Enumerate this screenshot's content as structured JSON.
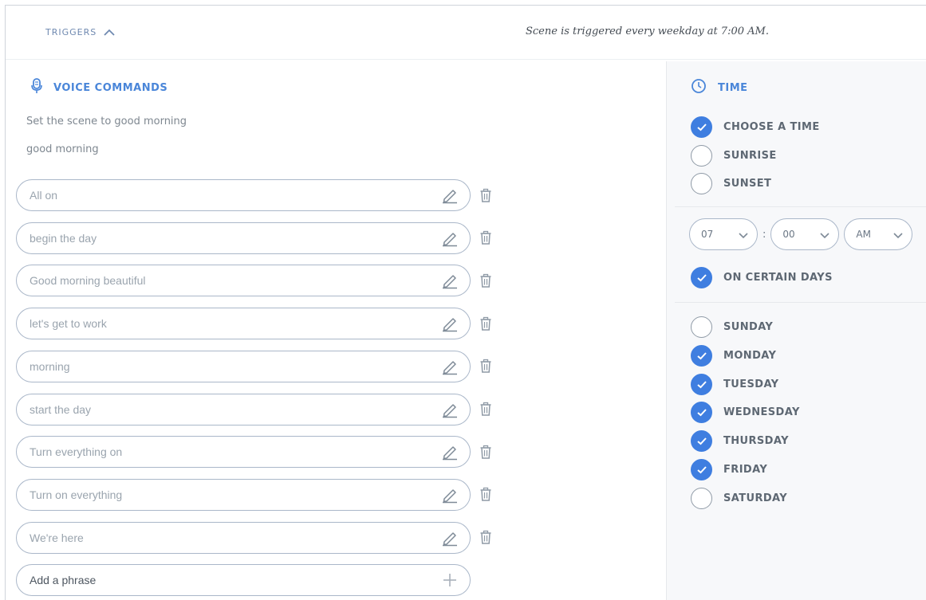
{
  "header": {
    "triggers_label": "TRIGGERS",
    "summary": "Scene is triggered every weekday at 7:00 AM."
  },
  "voice": {
    "title": "VOICE COMMANDS",
    "fixed_phrases": [
      "Set the scene to good morning",
      "good morning"
    ],
    "phrases": [
      "All on",
      "begin the day",
      "Good morning beautiful",
      "let's get to work",
      "morning",
      "start the day",
      "Turn everything on",
      "Turn on everything",
      "We're here"
    ],
    "add_placeholder": "Add a phrase"
  },
  "time": {
    "title": "TIME",
    "modes": [
      {
        "label": "CHOOSE A TIME",
        "selected": true
      },
      {
        "label": "SUNRISE",
        "selected": false
      },
      {
        "label": "SUNSET",
        "selected": false
      }
    ],
    "hour": "07",
    "minute": "00",
    "ampm": "AM",
    "certain_days_label": "ON CERTAIN DAYS",
    "certain_days_checked": true,
    "days": [
      {
        "label": "SUNDAY",
        "checked": false
      },
      {
        "label": "MONDAY",
        "checked": true
      },
      {
        "label": "TUESDAY",
        "checked": true
      },
      {
        "label": "WEDNESDAY",
        "checked": true
      },
      {
        "label": "THURSDAY",
        "checked": true
      },
      {
        "label": "FRIDAY",
        "checked": true
      },
      {
        "label": "SATURDAY",
        "checked": false
      }
    ]
  },
  "colors": {
    "accent": "#3f7ee0",
    "title_blue": "#4a86d9",
    "pill_border": "#aab7c9"
  },
  "icons": {
    "triggers": "chevron-up-icon",
    "voice": "microphone-icon",
    "time": "clock-icon",
    "edit": "pencil-icon",
    "delete": "trash-icon",
    "add": "plus-icon",
    "check": "check-icon",
    "dropdown": "chevron-down-icon"
  }
}
